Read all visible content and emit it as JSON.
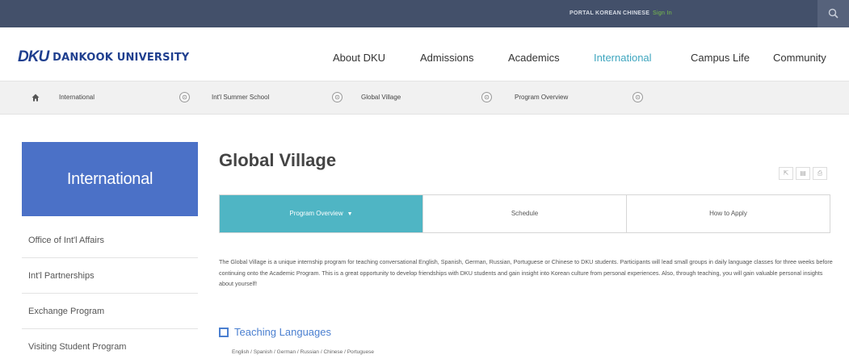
{
  "topbar": {
    "links": [
      "PORTAL",
      "KOREAN",
      "CHINESE",
      "Sign In"
    ]
  },
  "header": {
    "logo_mark": "DKU",
    "logo_text": "DANKOOK UNIVERSITY",
    "nav": [
      "About DKU",
      "Admissions",
      "Academics",
      "International",
      "Campus Life",
      "Community"
    ],
    "active_nav": "International"
  },
  "breadcrumb": {
    "items": [
      "International",
      "Int'l Summer School",
      "Global Village",
      "Program Overview"
    ],
    "toggle_glyph": "⊙"
  },
  "sidebar": {
    "title": "International",
    "items": [
      {
        "label": "Office of Int'l Affairs"
      },
      {
        "label": "Int'l Partnerships"
      },
      {
        "label": "Exchange Program"
      },
      {
        "label": "Visiting Student Program"
      }
    ]
  },
  "main": {
    "title": "Global Village",
    "tools": [
      "⇱",
      "▤",
      "⎙"
    ],
    "tabs": [
      {
        "label": "Program Overview",
        "caret": "▼",
        "active": true
      },
      {
        "label": "Schedule",
        "active": false
      },
      {
        "label": "How to Apply",
        "active": false
      }
    ],
    "description": "The Global Village is a unique internship program for teaching conversational English, Spanish, German, Russian, Portuguese or Chinese to DKU students. Participants will lead small groups in daily language classes for three weeks before continuing onto the Academic Program. This is a great opportunity to develop friendships with DKU students and gain insight into Korean culture from personal experiences. Also, through teaching, you will gain valuable personal insights about yourself!",
    "section_title": "Teaching Languages",
    "languages": "English / Spanish / German / Russian / Chinese / Portuguese"
  },
  "colors": {
    "topbar": "#43506a",
    "accent_teal": "#4fb5c4",
    "sidebar_blue": "#4b71c7",
    "link_blue": "#4a7fd0"
  }
}
